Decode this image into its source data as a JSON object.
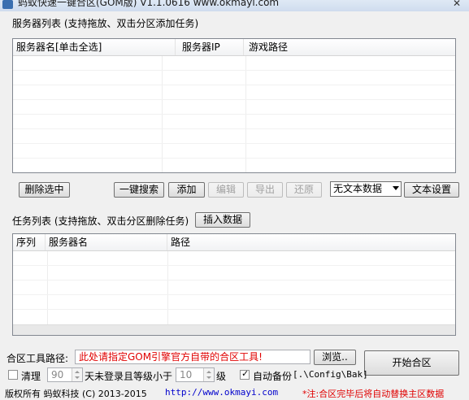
{
  "window": {
    "title": "蚂蚁快速一键合区(GOM版) V1.1.0616   www.okmayi.com"
  },
  "server_list": {
    "title": "服务器列表 (支持拖放、双击分区添加任务)",
    "columns": [
      "服务器名[单击全选]",
      "服务器IP",
      "游戏路径"
    ]
  },
  "server_toolbar": {
    "delete_selected": "删除选中",
    "one_click_search": "一键搜索",
    "add": "添加",
    "edit": "编辑",
    "export": "导出",
    "restore": "还原",
    "text_data_select": "无文本数据",
    "text_settings": "文本设置"
  },
  "task_list": {
    "title": "任务列表 (支持拖放、双击分区删除任务)",
    "insert_data": "插入数据",
    "columns": [
      "序列",
      "服务器名",
      "路径"
    ]
  },
  "merge_tool": {
    "label": "合区工具路径:",
    "path_value": "此处请指定GOM引擎官方自带的合区工具!",
    "browse": "浏览..",
    "start": "开始合区"
  },
  "options": {
    "cleanup_label": "清理",
    "days_value": "90",
    "days_text": "天未登录且等级小于",
    "level_value": "10",
    "level_unit": "级",
    "auto_backup_label": "自动备份",
    "backup_path": "[.\\Config\\Bak]"
  },
  "footer": {
    "copyright": "版权所有 蚂蚁科技 (C) 2013-2015",
    "url": "http://www.okmayi.com",
    "note": "*注:合区完毕后将自动替换主区数据"
  },
  "colors": {
    "warning_red": "#e00000",
    "link_blue": "#0000cc"
  }
}
